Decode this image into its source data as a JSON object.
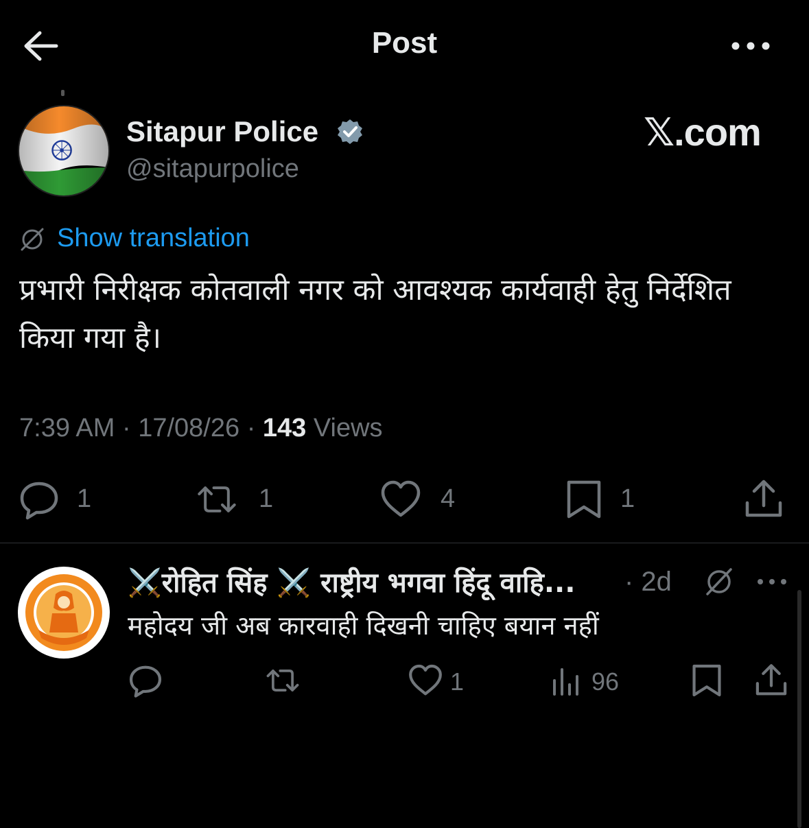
{
  "header": {
    "title": "Post",
    "back_icon": "arrow-left-icon",
    "more_icon": "more-horizontal-icon"
  },
  "author": {
    "name": "Sitapur Police",
    "handle": "@sitapurpolice",
    "verified": true,
    "avatar": "indian-flag-avatar"
  },
  "watermark": "𝕏.com",
  "translation": {
    "label": "Show translation",
    "icon": "globe-icon"
  },
  "post": {
    "text": "प्रभारी निरीक्षक कोतवाली नगर को आवश्यक कार्यवाही हेतु निर्देशित किया गया है।",
    "time": "7:39 AM",
    "date": "17/08/26",
    "views_count": "143",
    "views_label": "Views",
    "sep": "·"
  },
  "actions": {
    "replies": "1",
    "reposts": "1",
    "likes": "4",
    "bookmarks": "1"
  },
  "reply": {
    "name": "⚔️रोहित सिंह ⚔️ राष्ट्रीय भगवा हिंदू वाहि...",
    "dot_time": "· 2d",
    "text": "महोदय जी अब कारवाही दिखनी चाहिए बयान नहीं",
    "likes": "1",
    "views": "96"
  },
  "colors": {
    "accent": "#1d9bf0",
    "background": "#000000",
    "muted": "#71767b",
    "text": "#e7e9ea"
  }
}
